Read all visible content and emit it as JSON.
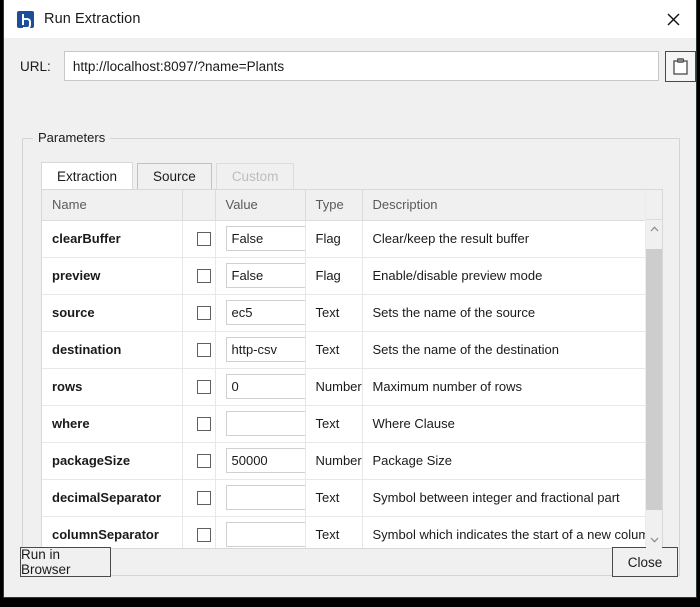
{
  "window": {
    "title": "Run Extraction",
    "app_icon": "burst-logo-icon",
    "close_icon": "close-icon"
  },
  "url_bar": {
    "label": "URL:",
    "value": "http://localhost:8097/?name=Plants",
    "placeholder": "",
    "copy_icon": "clipboard-icon"
  },
  "parameters": {
    "legend": "Parameters",
    "tabs": [
      {
        "label": "Extraction",
        "state": "selected"
      },
      {
        "label": "Source",
        "state": "normal"
      },
      {
        "label": "Custom",
        "state": "disabled"
      }
    ],
    "table": {
      "columns": [
        "Name",
        "",
        "Value",
        "Type",
        "Description"
      ],
      "rows": [
        {
          "name": "clearBuffer",
          "checked": false,
          "value": "False",
          "type": "Flag",
          "description": "Clear/keep the result buffer"
        },
        {
          "name": "preview",
          "checked": false,
          "value": "False",
          "type": "Flag",
          "description": "Enable/disable preview mode"
        },
        {
          "name": "source",
          "checked": false,
          "value": "ec5",
          "type": "Text",
          "description": "Sets the name of the source"
        },
        {
          "name": "destination",
          "checked": false,
          "value": "http-csv",
          "type": "Text",
          "description": "Sets the name of the destination"
        },
        {
          "name": "rows",
          "checked": false,
          "value": "0",
          "type": "Number",
          "description": "Maximum number of rows"
        },
        {
          "name": "where",
          "checked": false,
          "value": "",
          "type": "Text",
          "description": "Where Clause"
        },
        {
          "name": "packageSize",
          "checked": false,
          "value": "50000",
          "type": "Number",
          "description": "Package Size"
        },
        {
          "name": "decimalSeparator",
          "checked": false,
          "value": "",
          "type": "Text",
          "description": "Symbol between integer and fractional part"
        },
        {
          "name": "columnSeparator",
          "checked": false,
          "value": "",
          "type": "Text",
          "description": "Symbol which indicates the start of a new column"
        }
      ]
    },
    "scrollbar": {
      "up_icon": "chevron-up-icon",
      "down_icon": "chevron-down-icon"
    }
  },
  "footer": {
    "run_label": "Run in Browser",
    "close_label": "Close"
  },
  "colors": {
    "accent": "#1b4f9c",
    "window_bg": "#f0f0f0",
    "field_bg": "#ffffff"
  }
}
